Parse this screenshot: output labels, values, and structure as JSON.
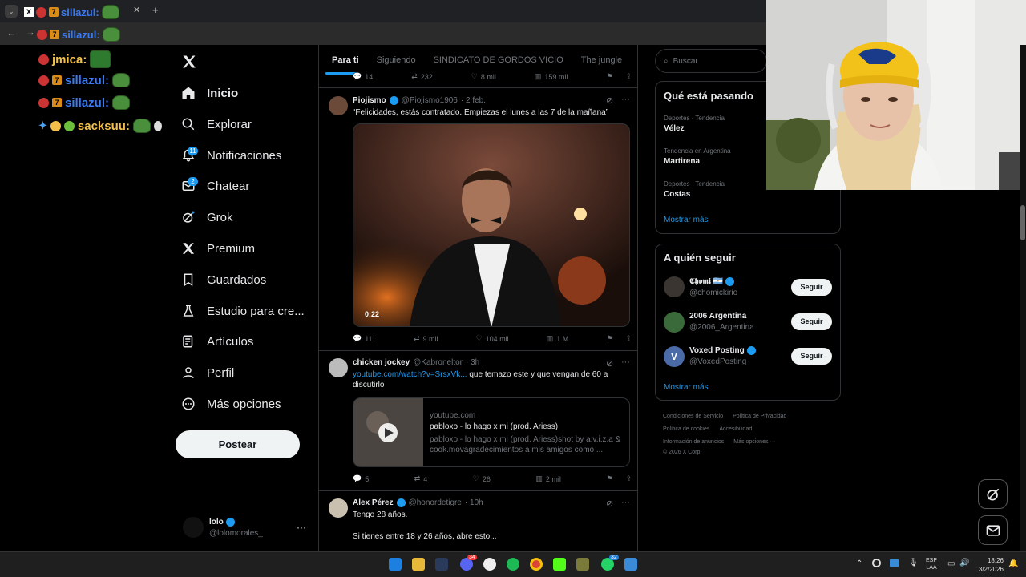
{
  "browser": {
    "tab_title": "sillazul:",
    "address_overlay": "sillazul:"
  },
  "chat_overlay": [
    {
      "user": "jmica:",
      "color": "#f2c04a"
    },
    {
      "user": "sillazul:",
      "color": "#3a7bf2"
    },
    {
      "user": "sillazul:",
      "color": "#3a7bf2"
    },
    {
      "user": "sacksuu:",
      "color": "#f2c04a"
    }
  ],
  "nav": {
    "items": [
      {
        "label": "Inicio",
        "icon": "home-icon"
      },
      {
        "label": "Explorar",
        "icon": "search-icon"
      },
      {
        "label": "Notificaciones",
        "icon": "bell-icon",
        "badge": "11"
      },
      {
        "label": "Chatear",
        "icon": "mail-icon",
        "badge": "2"
      },
      {
        "label": "Grok",
        "icon": "grok-icon"
      },
      {
        "label": "Premium",
        "icon": "x-logo-icon"
      },
      {
        "label": "Guardados",
        "icon": "bookmark-icon"
      },
      {
        "label": "Estudio para cre...",
        "icon": "flask-icon"
      },
      {
        "label": "Artículos",
        "icon": "article-icon"
      },
      {
        "label": "Perfil",
        "icon": "person-icon"
      },
      {
        "label": "Más opciones",
        "icon": "more-circle-icon"
      }
    ],
    "post_label": "Postear",
    "account": {
      "name": "lolo",
      "handle": "@lolomorales_"
    }
  },
  "tabs": [
    "Para ti",
    "Siguiendo",
    "SINDICATO DE GORDOS VICIO",
    "The jungle"
  ],
  "prev_actions": {
    "replies": "14",
    "reposts": "232",
    "likes": "8 mil",
    "views": "159 mil"
  },
  "posts": [
    {
      "name": "Piojismo",
      "handle": "@Piojismo1906",
      "time": "· 2 feb.",
      "text": "“Felicidades, estás contratado. Empiezas el lunes a las 7 de la mañana”",
      "video_duration": "0:22",
      "replies": "111",
      "reposts": "9 mil",
      "likes": "104 mil",
      "views": "1 M"
    },
    {
      "name": "chicken jockey",
      "handle": "@Kabroneltor",
      "time": "· 3h",
      "link": "youtube.com/watch?v=SrsxVk...",
      "text": " que temazo este y que vengan de 60 a discutirlo",
      "card_domain": "youtube.com",
      "card_title": "pabloxo - lo hago x mi (prod. Ariess)",
      "card_desc": "pabloxo - lo hago x mi (prod. Ariess)shot by a.v.i.z.a & cook.movagradecimientos a mis amigos como ...",
      "replies": "5",
      "reposts": "4",
      "likes": "26",
      "views": "2 mil"
    },
    {
      "name": "Alex Pérez",
      "handle": "@honordetigre",
      "time": "· 10h",
      "text": "Tengo 28 años.",
      "text2": "Si tienes entre 18 y 26 años, abre esto..."
    }
  ],
  "search_placeholder": "Buscar",
  "trends": {
    "title": "Qué está pasando",
    "items": [
      {
        "context": "Deportes · Tendencia",
        "name": "Vélez"
      },
      {
        "context": "Tendencia en Argentina",
        "name": "Martirena"
      },
      {
        "context": "Deportes · Tendencia",
        "name": "Costas"
      }
    ],
    "more": "Mostrar más"
  },
  "who_to_follow": {
    "title": "A quién seguir",
    "items": [
      {
        "name": "𝕮𝖍𝖔𝖒𝖎 🇦🇷",
        "handle": "@chomickirio",
        "button": "Seguir"
      },
      {
        "name": "2006 Argentina",
        "handle": "@2006_Argentina",
        "button": "Seguir"
      },
      {
        "name": "Voxed Posting",
        "handle": "@VoxedPosting",
        "button": "Seguir"
      }
    ],
    "more": "Mostrar más"
  },
  "footer": [
    "Condiciones de Servicio",
    "Política de Privacidad",
    "Política de cookies",
    "Accesibilidad",
    "Información de anuncios",
    "Más opciones ···",
    "© 2026 X Corp."
  ],
  "taskbar": {
    "lang1": "ESP",
    "lang2": "LAA",
    "time": "18:26",
    "date": "3/2/2026",
    "chrome_badge": "32",
    "discord_badge": "34"
  },
  "colors": {
    "accent": "#1d9bf0",
    "background": "#000000"
  }
}
